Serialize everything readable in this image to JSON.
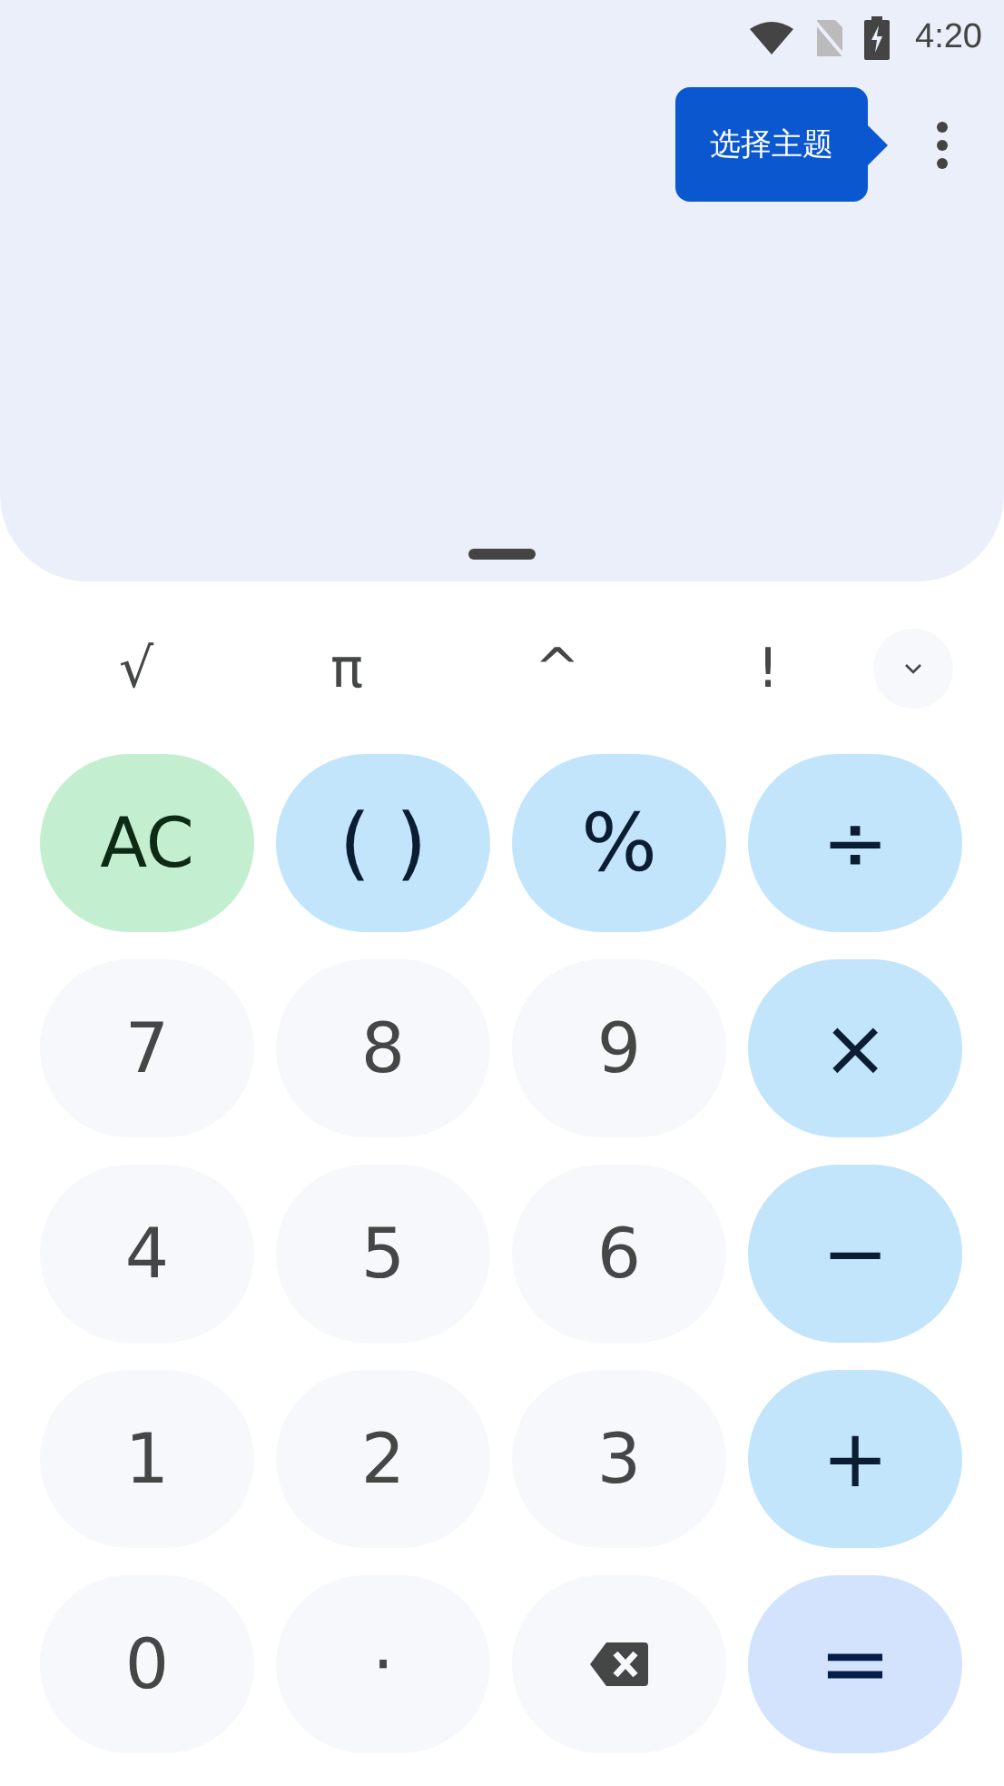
{
  "status_bar": {
    "time": "4:20"
  },
  "tooltip": {
    "text": "选择主题"
  },
  "scientific_keys": [
    "√",
    "π",
    "^",
    "!"
  ],
  "keys": [
    {
      "kind": "clear",
      "label": "AC"
    },
    {
      "kind": "op",
      "label": "( )"
    },
    {
      "kind": "op",
      "label": "%"
    },
    {
      "kind": "op",
      "label": "÷"
    },
    {
      "kind": "digit",
      "label": "7"
    },
    {
      "kind": "digit",
      "label": "8"
    },
    {
      "kind": "digit",
      "label": "9"
    },
    {
      "kind": "op",
      "label": "×"
    },
    {
      "kind": "digit",
      "label": "4"
    },
    {
      "kind": "digit",
      "label": "5"
    },
    {
      "kind": "digit",
      "label": "6"
    },
    {
      "kind": "op",
      "label": "−"
    },
    {
      "kind": "digit",
      "label": "1"
    },
    {
      "kind": "digit",
      "label": "2"
    },
    {
      "kind": "digit",
      "label": "3"
    },
    {
      "kind": "op",
      "label": "+"
    },
    {
      "kind": "digit",
      "label": "0"
    },
    {
      "kind": "digit",
      "label": "·"
    },
    {
      "kind": "backspace"
    },
    {
      "kind": "equals",
      "label": "="
    }
  ]
}
